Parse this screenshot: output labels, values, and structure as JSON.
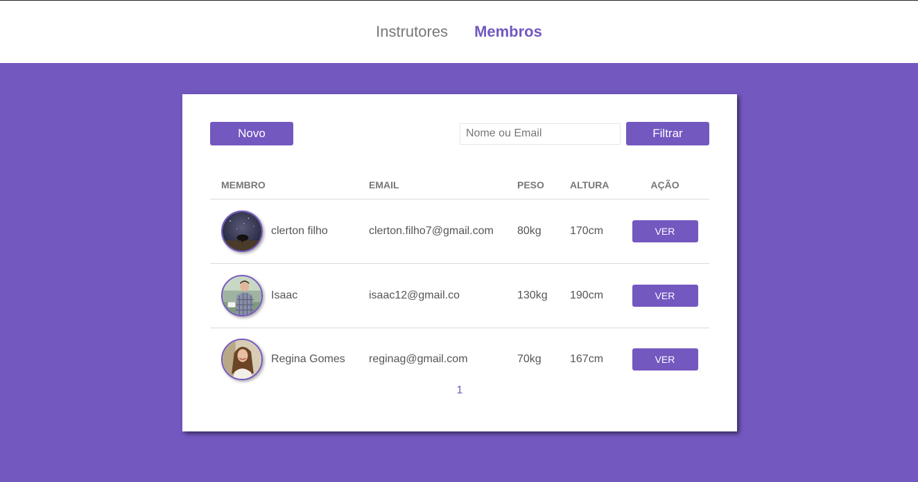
{
  "nav": {
    "items": [
      {
        "label": "Instrutores",
        "active": false
      },
      {
        "label": "Membros",
        "active": true
      }
    ]
  },
  "toolbar": {
    "new_label": "Novo",
    "search_placeholder": "Nome ou Email",
    "search_value": "",
    "filter_label": "Filtrar"
  },
  "table": {
    "headers": {
      "member": "MEMBRO",
      "email": "EMAIL",
      "weight": "PESO",
      "height": "ALTURA",
      "action": "AÇÃO"
    },
    "rows": [
      {
        "name": "clerton filho",
        "email": "clerton.filho7@gmail.com",
        "weight": "80kg",
        "height": "170cm",
        "action": "VER",
        "avatar": "night-sky-tree"
      },
      {
        "name": "Isaac",
        "email": "isaac12@gmail.co",
        "weight": "130kg",
        "height": "190cm",
        "action": "VER",
        "avatar": "man-plaid-shirt"
      },
      {
        "name": "Regina Gomes",
        "email": "reginag@gmail.com",
        "weight": "70kg",
        "height": "167cm",
        "action": "VER",
        "avatar": "smiling-woman"
      }
    ]
  },
  "pagination": {
    "pages": [
      "1"
    ],
    "current": "1"
  },
  "colors": {
    "accent": "#7358c0",
    "background": "#7358c0",
    "card": "#ffffff"
  }
}
